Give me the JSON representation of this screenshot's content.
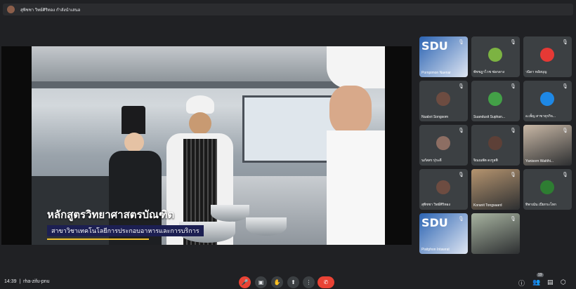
{
  "topbar": {
    "name": "สุพิชชา วิทย์ศิริทอง กำลังนำเสนอ"
  },
  "slide": {
    "title": "หลักสูตรวิทยาศาสตรบัณฑิต",
    "subtitle": "สาขาวิชาเทคโนโลยีการประกอบอาหารและการบริการ"
  },
  "participants": [
    {
      "name": "Pornpimon Naenar",
      "kind": "poster"
    },
    {
      "name": "พัชชฎาไวช ช่อกลาง",
      "kind": "avatar",
      "color": "#7cb342"
    },
    {
      "name": "วนิดา หอัยบุญ",
      "kind": "avatar",
      "color": "#e53935"
    },
    {
      "name": "Nualsri Songsom",
      "kind": "avatar",
      "color": "#6d4c41"
    },
    {
      "name": "Suandusit Suphan...",
      "kind": "avatar",
      "color": "#43a047"
    },
    {
      "name": "อ.เพ็ญ สาขาธุรกิจ...",
      "kind": "avatar",
      "color": "#1e88e5"
    },
    {
      "name": "นภัสสร ปุระดี",
      "kind": "avatar",
      "color": "#8d6e63"
    },
    {
      "name": "จิณณพัต ดงรูสติ",
      "kind": "avatar",
      "color": "#5d4037"
    },
    {
      "name": "Yanisorn Waitthi...",
      "kind": "photo",
      "color": "#c9b8a6"
    },
    {
      "name": "สุพิชชา วิทย์ศิริทอง",
      "kind": "avatar",
      "color": "#6d4c41"
    },
    {
      "name": "Koranit Tongsaard",
      "kind": "photo",
      "color": "#b5946f"
    },
    {
      "name": "ทิพาณัน เปียกระโทก",
      "kind": "avatar",
      "color": "#2e7d32"
    },
    {
      "name": "Pisitphon Intawrat",
      "kind": "poster"
    },
    {
      "name": "",
      "kind": "photo",
      "color": "#a7b3a0"
    }
  ],
  "bottom": {
    "time": "14:39",
    "meeting_code": "rha-zifu-pnu",
    "people_count": "19"
  },
  "colors": {
    "end_call": "#ea4335",
    "mic_off": "#ea4335",
    "background": "#202124"
  }
}
